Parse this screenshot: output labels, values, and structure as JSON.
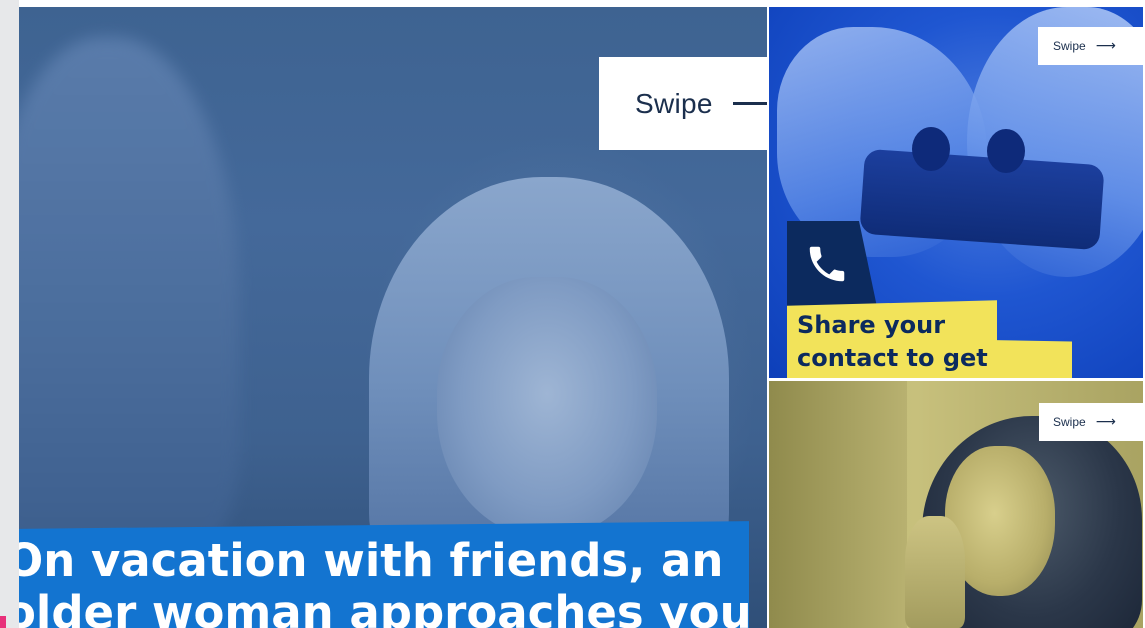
{
  "tiles": {
    "main": {
      "swipe_label": "Swipe",
      "caption": "On vacation with friends, an older woman approaches you",
      "caption_color": "#1374d0"
    },
    "phone": {
      "swipe_label": "Swipe",
      "yellow_text_line1": "Share your",
      "yellow_text_line2": "contact to get",
      "accent_color": "#f2e35a",
      "icon": "phone-icon"
    },
    "girl": {
      "swipe_label": "Swipe"
    }
  },
  "icons": {
    "arrow": "arrow-right-icon"
  }
}
